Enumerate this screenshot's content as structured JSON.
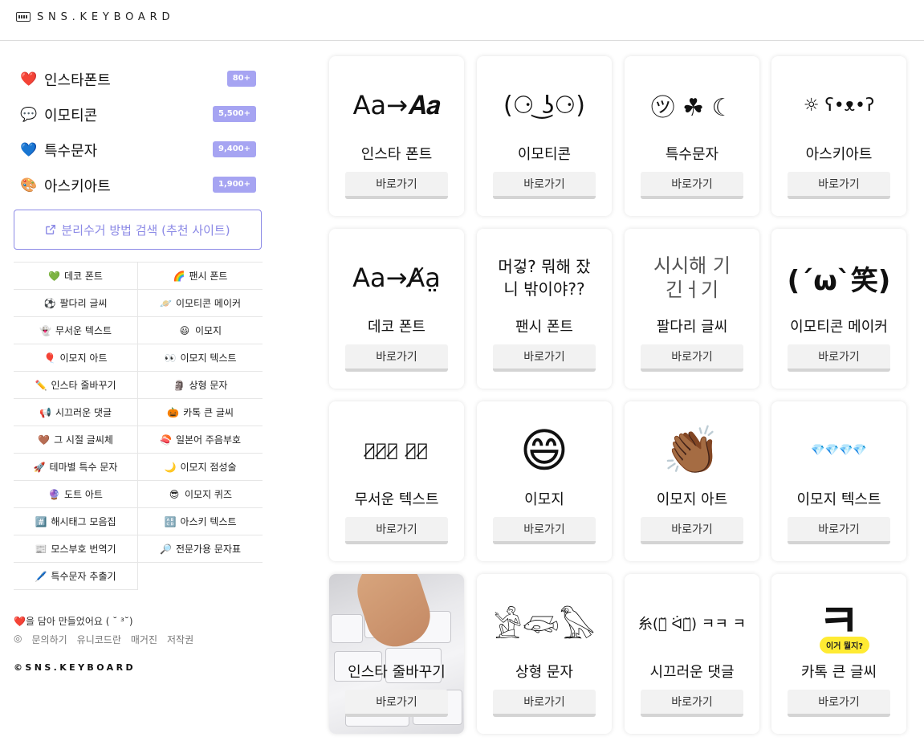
{
  "brand": {
    "name": "SNS.KEYBOARD"
  },
  "categories": [
    {
      "icon": "heart-red",
      "emoji": "❤️",
      "label": "인스타폰트",
      "badge": "80+"
    },
    {
      "icon": "speech-bubble",
      "emoji": "💬",
      "label": "이모티콘",
      "badge": "5,500+"
    },
    {
      "icon": "heart-blue",
      "emoji": "💙",
      "label": "특수문자",
      "badge": "9,400+"
    },
    {
      "icon": "palette",
      "emoji": "🎨",
      "label": "아스키아트",
      "badge": "1,900+"
    }
  ],
  "search_button": {
    "label": "분리수거 방법 검색 (추천 사이트)"
  },
  "links": [
    [
      {
        "emoji": "💚",
        "label": "데코 폰트"
      },
      {
        "emoji": "🌈",
        "label": "팬시 폰트"
      }
    ],
    [
      {
        "emoji": "⚽",
        "label": "팔다리 글씨"
      },
      {
        "emoji": "🪐",
        "label": "이모티콘 메이커"
      }
    ],
    [
      {
        "emoji": "👻",
        "label": "무서운 텍스트"
      },
      {
        "emoji": "😃",
        "label": "이모지"
      }
    ],
    [
      {
        "emoji": "🎈",
        "label": "이모지 아트"
      },
      {
        "emoji": "👀",
        "label": "이모지 텍스트"
      }
    ],
    [
      {
        "emoji": "✏️",
        "label": "인스타 줄바꾸기"
      },
      {
        "emoji": "🗿",
        "label": "상형 문자"
      }
    ],
    [
      {
        "emoji": "📢",
        "label": "시끄러운 댓글"
      },
      {
        "emoji": "🎃",
        "label": "카톡 큰 글씨"
      }
    ],
    [
      {
        "emoji": "🤎",
        "label": "그 시절 글씨체"
      },
      {
        "emoji": "🍣",
        "label": "일본어 주음부호"
      }
    ],
    [
      {
        "emoji": "🚀",
        "label": "테마별 특수 문자"
      },
      {
        "emoji": "🌙",
        "label": "이모지 점성술"
      }
    ],
    [
      {
        "emoji": "🔮",
        "label": "도트 아트"
      },
      {
        "emoji": "😎",
        "label": "이모지 퀴즈"
      }
    ],
    [
      {
        "emoji": "#️⃣",
        "label": "해시태그 모음집"
      },
      {
        "emoji": "🔠",
        "label": "아스키 텍스트"
      }
    ],
    [
      {
        "emoji": "📰",
        "label": "모스부호 번역기"
      },
      {
        "emoji": "🔎",
        "label": "전문가용 문자표"
      }
    ],
    [
      {
        "emoji": "🖊️",
        "label": "특수문자 추출기"
      },
      {
        "emoji": "",
        "label": ""
      }
    ]
  ],
  "footer": {
    "made_with": "을 담아 만들었어요 ( ˘ ³˘)",
    "heart": "❤️",
    "links": [
      "문의하기",
      "유니코드란",
      "매거진",
      "저작권"
    ],
    "copyright": "©SNS.KEYBOARD"
  },
  "cards": [
    {
      "title": "인스타 폰트",
      "art": "Aa→𝑨𝒂",
      "button": "바로가기"
    },
    {
      "title": "이모티콘",
      "art": "(⚆ ͜ʖ⚆)",
      "button": "바로가기"
    },
    {
      "title": "특수문자",
      "art": "㋡ ☘ ☾",
      "button": "바로가기"
    },
    {
      "title": "아스키아트",
      "art": "☼ ʕ•ᴥ•ʔ",
      "button": "바로가기"
    },
    {
      "title": "데코 폰트",
      "art": "Aa→A̸a̤",
      "button": "바로가기"
    },
    {
      "title": "팬시 폰트",
      "art": "머겋? 뭐해 잤니 밖이야??",
      "button": "바로가기"
    },
    {
      "title": "팔다리 글씨",
      "art": "시시해 기긴ㅓ기",
      "button": "바로가기"
    },
    {
      "title": "이모티콘 메이커",
      "art": "(´ω`笑)",
      "button": "바로가기"
    },
    {
      "title": "무서운 텍스트",
      "art": "무̷서̷운̷ 글̷씨̷",
      "button": "바로가기"
    },
    {
      "title": "이모지",
      "art": "😄",
      "button": "바로가기"
    },
    {
      "title": "이모지 아트",
      "art": "👏🏾",
      "button": "바로가기"
    },
    {
      "title": "이모지 텍스트",
      "art": "💎💎💎💎",
      "button": "바로가기"
    },
    {
      "title": "인스타 줄바꾸기",
      "art": "",
      "button": "바로가기"
    },
    {
      "title": "상형 문자",
      "art": "𓀀𓆛𓅃",
      "button": "바로가기"
    },
    {
      "title": "시끄러운 댓글",
      "art": "糸(･̆ ᐛ･̆) ㅋㅋ ㅋ",
      "button": "바로가기"
    },
    {
      "title": "카톡 큰 글씨",
      "art": "ㅋ",
      "bubble": "이거 뭘지?",
      "button": "바로가기"
    }
  ]
}
